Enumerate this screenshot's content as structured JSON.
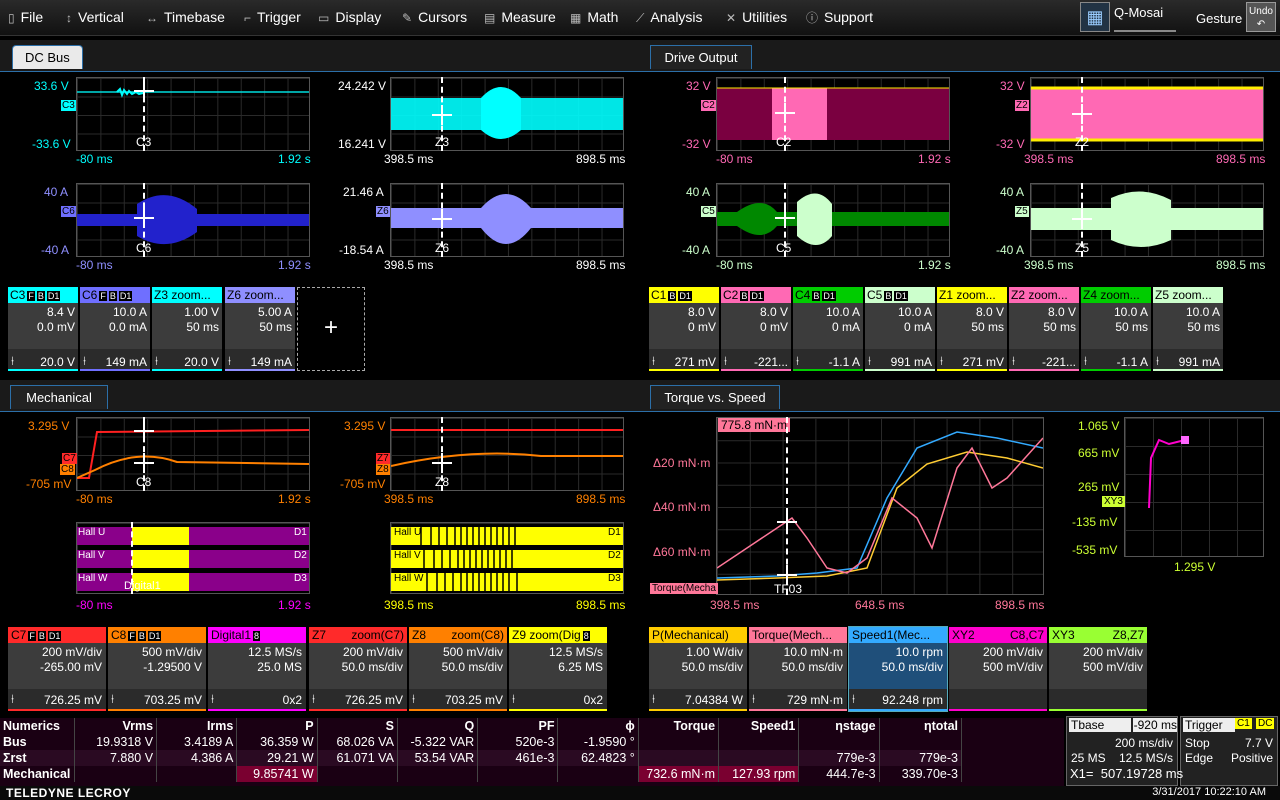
{
  "menu": {
    "items": [
      {
        "label": "File",
        "icon": "file-icon"
      },
      {
        "label": "Vertical",
        "icon": "vertical-icon"
      },
      {
        "label": "Timebase",
        "icon": "timebase-icon"
      },
      {
        "label": "Trigger",
        "icon": "trigger-icon"
      },
      {
        "label": "Display",
        "icon": "display-icon"
      },
      {
        "label": "Cursors",
        "icon": "cursors-icon"
      },
      {
        "label": "Measure",
        "icon": "measure-icon"
      },
      {
        "label": "Math",
        "icon": "math-icon"
      },
      {
        "label": "Analysis",
        "icon": "analysis-icon"
      },
      {
        "label": "Utilities",
        "icon": "utilities-icon"
      },
      {
        "label": "Support",
        "icon": "support-icon"
      }
    ],
    "qmosaic": "Q-Mosai",
    "gesture": "Gesture",
    "undo": "Undo"
  },
  "tabs": {
    "dc_bus": "DC Bus",
    "drive_output": "Drive Output",
    "mechanical": "Mechanical",
    "torque_speed": "Torque vs. Speed"
  },
  "plots": {
    "c3": {
      "top": "33.6 V",
      "bottom": "-33.6 V",
      "trace": "C3",
      "tag": "C3",
      "xl": "-80 ms",
      "xr": "1.92 s"
    },
    "z3": {
      "top": "24.242 V",
      "bottom": "16.241 V",
      "trace": "Z3",
      "tag": "Z3",
      "xl": "398.5 ms",
      "xr": "898.5 ms"
    },
    "c6": {
      "top": "40 A",
      "bottom": "-40 A",
      "trace": "C6",
      "tag": "C6",
      "xl": "-80 ms",
      "xr": "1.92 s"
    },
    "z6": {
      "top": "21.46 A",
      "bottom": "-18.54 A",
      "trace": "Z6",
      "tag": "Z6",
      "xl": "398.5 ms",
      "xr": "898.5 ms"
    },
    "c2": {
      "top": "32 V",
      "bottom": "-32 V",
      "trace": "C2",
      "tag": "C2",
      "xl": "-80 ms",
      "xr": "1.92 s"
    },
    "z2": {
      "top": "32 V",
      "bottom": "-32 V",
      "trace": "Z2",
      "tag": "Z2",
      "xl": "398.5 ms",
      "xr": "898.5 ms"
    },
    "c5": {
      "top": "40 A",
      "bottom": "-40 A",
      "trace": "C5",
      "tag": "C5",
      "xl": "-80 ms",
      "xr": "1.92 s"
    },
    "z5": {
      "top": "40 A",
      "bottom": "-40 A",
      "trace": "Z5",
      "tag": "Z5",
      "xl": "398.5 ms",
      "xr": "898.5 ms"
    },
    "c7": {
      "top": "3.295 V",
      "bottom": "-705 mV",
      "trace": "C8",
      "tag1": "C7",
      "tag2": "C8",
      "xl": "-80 ms",
      "xr": "1.92 s"
    },
    "z7": {
      "top": "3.295 V",
      "bottom": "-705 mV",
      "trace": "Z8",
      "tag1": "Z7",
      "tag2": "Z8",
      "xl": "398.5 ms",
      "xr": "898.5 ms"
    },
    "digital": {
      "rows": [
        "Hall U",
        "Hall V",
        "Hall W"
      ],
      "ends": [
        "D1",
        "D2",
        "D3"
      ],
      "trace": "Digital1",
      "xl": "-80 ms",
      "xr": "1.92 s"
    },
    "z9": {
      "rows": [
        "Hall U",
        "Hall V",
        "Hall W"
      ],
      "ends": [
        "D1",
        "D2",
        "D3"
      ],
      "xl": "398.5 ms",
      "xr": "898.5 ms"
    },
    "torque": {
      "cursor": "775.8 mN·m",
      "y1": "Δ20 mN·m",
      "y2": "Δ40 mN·m",
      "y3": "Δ60 mN·m",
      "tag": "Torque(Mecha",
      "trace": "TF03",
      "xl": "398.5 ms",
      "xm": "648.5 ms",
      "xr": "898.5 ms"
    },
    "xy": {
      "y1": "1.065 V",
      "y2": "665 mV",
      "y3": "265 mV",
      "y4": "-135 mV",
      "y5": "-535 mV",
      "tag": "XY3",
      "x": "1.295 V"
    }
  },
  "dc_boxes": [
    {
      "name": "C3",
      "flags": [
        "F",
        "B",
        "D1"
      ],
      "v1": "8.4 V",
      "v2": "0.0 mV",
      "ft": "20.0 V",
      "color": "#00ffff"
    },
    {
      "name": "C6",
      "flags": [
        "F",
        "B",
        "D1"
      ],
      "v1": "10.0 A",
      "v2": "0.0 mA",
      "ft": "149 mA",
      "color": "#6f6fff"
    },
    {
      "name": "Z3 zoom...",
      "flags": [],
      "v1": "1.00 V",
      "v2": "50 ms",
      "ft": "20.0 V",
      "color": "#00ffff"
    },
    {
      "name": "Z6 zoom...",
      "flags": [],
      "v1": "5.00 A",
      "v2": "50 ms",
      "ft": "149 mA",
      "color": "#8f8fff"
    }
  ],
  "drive_boxes": [
    {
      "name": "C1",
      "flags": [
        "B",
        "D1"
      ],
      "v1": "8.0 V",
      "v2": "0 mV",
      "ft": "271 mV",
      "color": "#ffff00"
    },
    {
      "name": "C2",
      "flags": [
        "B",
        "D1"
      ],
      "v1": "8.0 V",
      "v2": "0 mV",
      "ft": "-221...",
      "color": "#ff69b4"
    },
    {
      "name": "C4",
      "flags": [
        "B",
        "D1"
      ],
      "v1": "10.0 A",
      "v2": "0 mA",
      "ft": "-1.1 A",
      "color": "#00cc00"
    },
    {
      "name": "C5",
      "flags": [
        "B",
        "D1"
      ],
      "v1": "10.0 A",
      "v2": "0 mA",
      "ft": "991 mA",
      "color": "#ccffcc"
    },
    {
      "name": "Z1 zoom...",
      "flags": [],
      "v1": "8.0 V",
      "v2": "50 ms",
      "ft": "271 mV",
      "color": "#ffff00"
    },
    {
      "name": "Z2 zoom...",
      "flags": [],
      "v1": "8.0 V",
      "v2": "50 ms",
      "ft": "-221...",
      "color": "#ff69b4"
    },
    {
      "name": "Z4 zoom...",
      "flags": [],
      "v1": "10.0 A",
      "v2": "50 ms",
      "ft": "-1.1 A",
      "color": "#00cc00"
    },
    {
      "name": "Z5 zoom...",
      "flags": [],
      "v1": "10.0 A",
      "v2": "50 ms",
      "ft": "991 mA",
      "color": "#ccffcc"
    }
  ],
  "mech_boxes": [
    {
      "name": "C7",
      "flags": [
        "F",
        "B",
        "D1"
      ],
      "v1": "200 mV/div",
      "v2": "-265.00 mV",
      "ft": "726.25 mV",
      "color": "#ff2a2a"
    },
    {
      "name": "C8",
      "flags": [
        "F",
        "B",
        "D1"
      ],
      "v1": "500 mV/div",
      "v2": "-1.29500 V",
      "ft": "703.25 mV",
      "color": "#ff8000"
    },
    {
      "name": "Digital1",
      "flags": [
        "8"
      ],
      "v1": "12.5 MS/s",
      "v2": "25.0 MS",
      "ft": "0x2",
      "color": "#ff00ff"
    },
    {
      "name": "Z7",
      "sub": "zoom(C7)",
      "v1": "200 mV/div",
      "v2": "50.0 ms/div",
      "ft": "726.25 mV",
      "color": "#ff2a2a"
    },
    {
      "name": "Z8",
      "sub": "zoom(C8)",
      "v1": "500 mV/div",
      "v2": "50.0 ms/div",
      "ft": "703.25 mV",
      "color": "#ff8000"
    },
    {
      "name": "Z9 zoom(Dig",
      "flags": [
        "8"
      ],
      "v1": "12.5 MS/s",
      "v2": "6.25 MS",
      "ft": "0x2",
      "color": "#ffff00"
    }
  ],
  "tq_boxes": [
    {
      "name": "P(Mechanical)",
      "v1": "1.00 W/div",
      "v2": "50.0 ms/div",
      "ft": "7.04384 W",
      "color": "#ffcc00"
    },
    {
      "name": "Torque(Mech...",
      "v1": "10.0 mN·m",
      "v2": "50.0 ms/div",
      "ft": "729 mN·m",
      "color": "#ff7799"
    },
    {
      "name": "Speed1(Mec...",
      "v1": "10.0 rpm",
      "v2": "50.0 ms/div",
      "ft": "92.248 rpm",
      "color": "#33aaff",
      "selected": true
    },
    {
      "name": "XY2",
      "sub": "C8,C7",
      "v1": "200 mV/div",
      "v2": "500 mV/div",
      "ft": "",
      "color": "#ff00cc"
    },
    {
      "name": "XY3",
      "sub": "Z8,Z7",
      "v1": "200 mV/div",
      "v2": "500 mV/div",
      "ft": "",
      "color": "#99ff33"
    }
  ],
  "numerics": {
    "headers": [
      "Numerics",
      "Vrms",
      "Irms",
      "P",
      "S",
      "Q",
      "PF",
      "ϕ",
      "Torque",
      "Speed1",
      "ηstage",
      "ηtotal"
    ],
    "rows": [
      [
        "Bus",
        "19.9318 V",
        "3.4189 A",
        "36.359 W",
        "68.026 VA",
        "-5.322 VAR",
        "520e-3",
        "-1.9590 °",
        "",
        "",
        "",
        ""
      ],
      [
        "Σrst",
        "7.880 V",
        "4.386 A",
        "29.21 W",
        "61.071 VA",
        "53.54 VAR",
        "461e-3",
        "62.4823 °",
        "",
        "",
        "779e-3",
        "779e-3"
      ],
      [
        "Mechanical",
        "",
        "",
        "9.85741 W",
        "",
        "",
        "",
        "",
        "732.6 mN·m",
        "127.93 rpm",
        "444.7e-3",
        "339.70e-3"
      ]
    ]
  },
  "tbase": {
    "label": "Tbase",
    "delay": "-920 ms",
    "div": "200 ms/div",
    "samples": "25 MS",
    "rate": "12.5 MS/s"
  },
  "trigger": {
    "label": "Trigger",
    "ch": "C1",
    "coupling": "DC",
    "mode": "Stop",
    "level": "7.7 V",
    "type": "Edge",
    "slope": "Positive"
  },
  "cursor_readout": {
    "label": "X1=",
    "value": "507.19728 ms"
  },
  "footer": {
    "brand": "TELEDYNE LECROY",
    "timestamp": "3/31/2017 10:22:10 AM"
  },
  "add_label": "+"
}
